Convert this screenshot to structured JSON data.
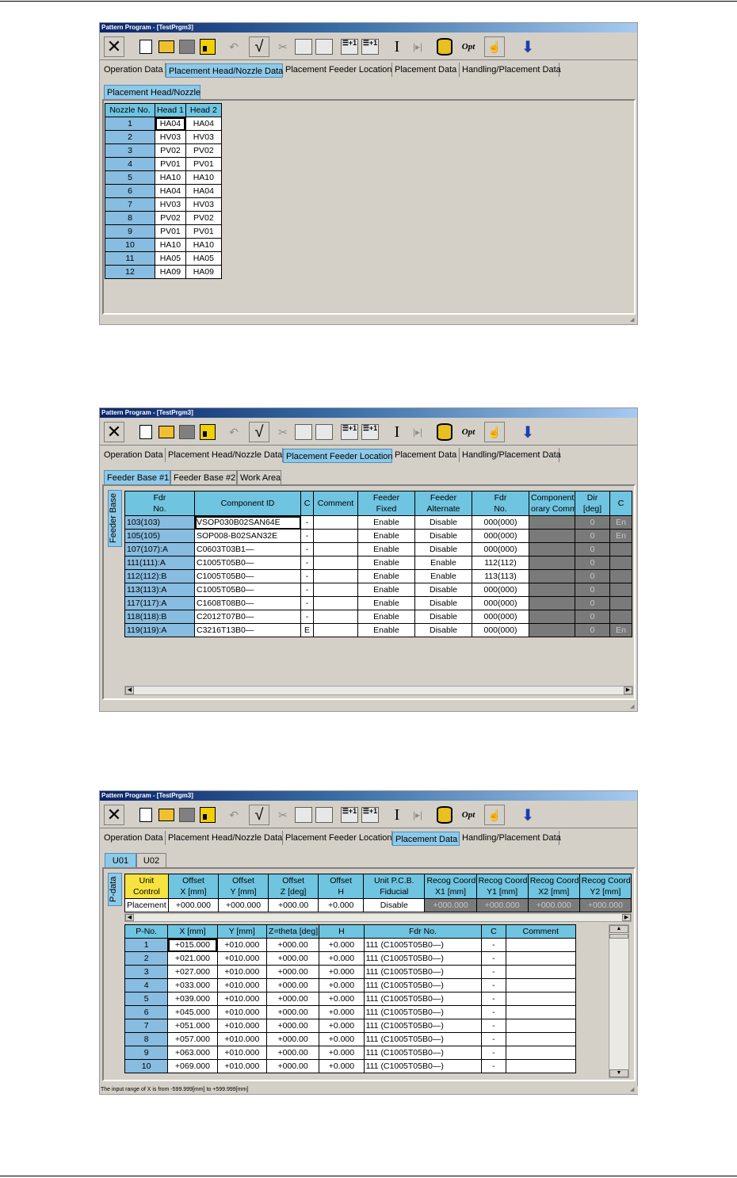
{
  "window_title": "Pattern Program - [TestPrgm3]",
  "main_tabs": [
    "Operation Data",
    "Placement Head/Nozzle Data",
    "Placement Feeder Location",
    "Placement Data",
    "Handling/Placement Data"
  ],
  "screen1": {
    "subtab": "Placement Head/Nozzle",
    "headers": [
      "Nozzle No.",
      "Head 1",
      "Head 2"
    ],
    "rows": [
      [
        "1",
        "HA04",
        "HA04"
      ],
      [
        "2",
        "HV03",
        "HV03"
      ],
      [
        "3",
        "PV02",
        "PV02"
      ],
      [
        "4",
        "PV01",
        "PV01"
      ],
      [
        "5",
        "HA10",
        "HA10"
      ],
      [
        "6",
        "HA04",
        "HA04"
      ],
      [
        "7",
        "HV03",
        "HV03"
      ],
      [
        "8",
        "PV02",
        "PV02"
      ],
      [
        "9",
        "PV01",
        "PV01"
      ],
      [
        "10",
        "HA10",
        "HA10"
      ],
      [
        "11",
        "HA05",
        "HA05"
      ],
      [
        "12",
        "HA09",
        "HA09"
      ]
    ]
  },
  "screen2": {
    "subtabs": [
      "Feeder Base #1",
      "Feeder Base #2",
      "Work Area"
    ],
    "side_tab": "Feeder Base",
    "headers": [
      [
        "Fdr",
        "No."
      ],
      [
        "Component ID",
        ""
      ],
      [
        "C",
        ""
      ],
      [
        "Comment",
        ""
      ],
      [
        "Feeder",
        "Fixed"
      ],
      [
        "Feeder",
        "Alternate"
      ],
      [
        "Fdr",
        "No."
      ],
      [
        "Component",
        "orary Comme"
      ],
      [
        "Dir",
        "[deg]"
      ],
      [
        "C",
        ""
      ]
    ],
    "rows": [
      [
        "103(103)",
        "VSOP030B02SAN64E",
        "-",
        "",
        "Enable",
        "Disable",
        "000(000)",
        "",
        "0",
        "En"
      ],
      [
        "105(105)",
        "SOP008-B02SAN32E",
        "-",
        "",
        "Enable",
        "Disable",
        "000(000)",
        "",
        "0",
        "En"
      ],
      [
        "107(107):A",
        "C0603T03B1—",
        "-",
        "",
        "Enable",
        "Disable",
        "000(000)",
        "",
        "0",
        ""
      ],
      [
        "111(111):A",
        "C1005T05B0—",
        "-",
        "",
        "Enable",
        "Enable",
        "112(112)",
        "",
        "0",
        ""
      ],
      [
        "112(112):B",
        "C1005T05B0—",
        "-",
        "",
        "Enable",
        "Enable",
        "113(113)",
        "",
        "0",
        ""
      ],
      [
        "113(113):A",
        "C1005T05B0—",
        "-",
        "",
        "Enable",
        "Disable",
        "000(000)",
        "",
        "0",
        ""
      ],
      [
        "117(117):A",
        "C1608T08B0—",
        "-",
        "",
        "Enable",
        "Disable",
        "000(000)",
        "",
        "0",
        ""
      ],
      [
        "118(118):B",
        "C2012T07B0—",
        "-",
        "",
        "Enable",
        "Disable",
        "000(000)",
        "",
        "0",
        ""
      ],
      [
        "119(119):A",
        "C3216T13B0—",
        "E",
        "",
        "Enable",
        "Disable",
        "000(000)",
        "",
        "0",
        "En"
      ]
    ]
  },
  "screen3": {
    "subtabs": [
      "U01",
      "U02"
    ],
    "side_tab": "P-data",
    "unit_headers": [
      [
        "Unit",
        "Control"
      ],
      [
        "Offset",
        "X [mm]"
      ],
      [
        "Offset",
        "Y [mm]"
      ],
      [
        "Offset",
        "Z [deg]"
      ],
      [
        "Offset",
        "H"
      ],
      [
        "Unit P.C.B.",
        "Fiducial"
      ],
      [
        "Recog Coord",
        "X1 [mm]"
      ],
      [
        "Recog Coord",
        "Y1 [mm]"
      ],
      [
        "Recog Coord",
        "X2 [mm]"
      ],
      [
        "Recog Coord",
        "Y2 [mm]"
      ]
    ],
    "unit_values": [
      "Placement",
      "+000.000",
      "+000.000",
      "+000.00",
      "+0.000",
      "Disable",
      "+000.000",
      "+000.000",
      "+000.000",
      "+000.000"
    ],
    "headers": [
      "P-No.",
      "X [mm]",
      "Y [mm]",
      "Z=theta [deg]",
      "H",
      "Fdr No.",
      "C",
      "Comment"
    ],
    "rows": [
      [
        "1",
        "+015.000",
        "+010.000",
        "+000.00",
        "+0.000",
        "111 (C1005T05B0—)",
        "-",
        ""
      ],
      [
        "2",
        "+021.000",
        "+010.000",
        "+000.00",
        "+0.000",
        "111 (C1005T05B0—)",
        "-",
        ""
      ],
      [
        "3",
        "+027.000",
        "+010.000",
        "+000.00",
        "+0.000",
        "111 (C1005T05B0—)",
        "-",
        ""
      ],
      [
        "4",
        "+033.000",
        "+010.000",
        "+000.00",
        "+0.000",
        "111 (C1005T05B0—)",
        "-",
        ""
      ],
      [
        "5",
        "+039.000",
        "+010.000",
        "+000.00",
        "+0.000",
        "111 (C1005T05B0—)",
        "-",
        ""
      ],
      [
        "6",
        "+045.000",
        "+010.000",
        "+000.00",
        "+0.000",
        "111 (C1005T05B0—)",
        "-",
        ""
      ],
      [
        "7",
        "+051.000",
        "+010.000",
        "+000.00",
        "+0.000",
        "111 (C1005T05B0—)",
        "-",
        ""
      ],
      [
        "8",
        "+057.000",
        "+010.000",
        "+000.00",
        "+0.000",
        "111 (C1005T05B0—)",
        "-",
        ""
      ],
      [
        "9",
        "+063.000",
        "+010.000",
        "+000.00",
        "+0.000",
        "111 (C1005T05B0—)",
        "-",
        ""
      ],
      [
        "10",
        "+069.000",
        "+010.000",
        "+000.00",
        "+0.000",
        "111 (C1005T05B0—)",
        "-",
        ""
      ]
    ],
    "status": "The input range of  X is from  -599.999[mm]  to  +599.999[mm]"
  },
  "toolbar_icons": [
    "close-icon",
    "new-file-icon",
    "open-folder-icon",
    "minus-icon",
    "save-icon",
    "undo-icon",
    "check-icon",
    "cut-icon",
    "copy-icon",
    "paste-icon",
    "insert-row-icon",
    "add-row-icon",
    "text-cursor-icon",
    "jump-icon",
    "database-icon",
    "optimize-icon",
    "hand-icon",
    "download-arrow-icon"
  ],
  "toolbar_text": {
    "close": "✕",
    "check": "√",
    "cut": "✂",
    "copy": "⎘",
    "paste": "📋",
    "undo": "↶",
    "text_cursor": "I",
    "jump": "|▸|",
    "optimize": "Opt",
    "hand": "☝",
    "arrow": "⬇",
    "insert": "☰+1",
    "add": "☰+1",
    "db": "DB"
  }
}
